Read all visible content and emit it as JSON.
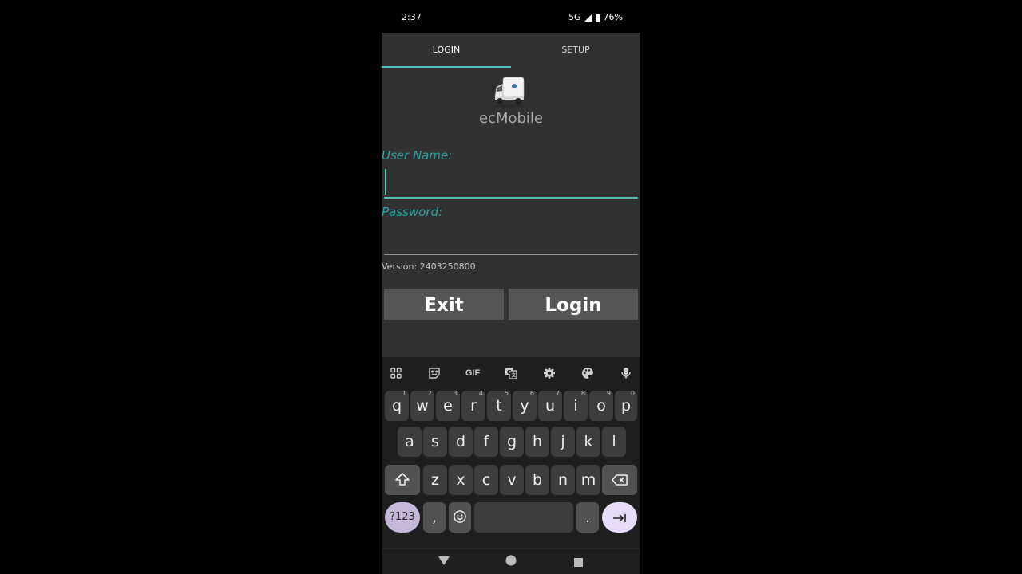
{
  "status_bar": {
    "time": "2:37",
    "network": "5G",
    "battery": "76%"
  },
  "tabs": [
    {
      "label": "LOGIN",
      "active": true
    },
    {
      "label": "SETUP",
      "active": false
    }
  ],
  "app": {
    "name": "ecMobile",
    "logo_icon": "delivery-truck-icon"
  },
  "form": {
    "username_label": "User Name:",
    "username_value": "",
    "password_label": "Password:",
    "password_value": ""
  },
  "version_text": "Version: 2403250800",
  "buttons": {
    "exit": "Exit",
    "login": "Login"
  },
  "keyboard": {
    "toolbar": [
      "apps-grid-icon",
      "sticker-icon",
      "GIF",
      "translate-icon",
      "gear-icon",
      "palette-icon",
      "microphone-icon"
    ],
    "gif_label": "GIF",
    "row1": [
      "q",
      "w",
      "e",
      "r",
      "t",
      "y",
      "u",
      "i",
      "o",
      "p"
    ],
    "row1_hints": [
      "1",
      "2",
      "3",
      "4",
      "5",
      "6",
      "7",
      "8",
      "9",
      "0"
    ],
    "row2": [
      "a",
      "s",
      "d",
      "f",
      "g",
      "h",
      "j",
      "k",
      "l"
    ],
    "row3": [
      "z",
      "x",
      "c",
      "v",
      "b",
      "n",
      "m"
    ],
    "symbols_key": "?123",
    "comma_key": ",",
    "period_key": "."
  },
  "colors": {
    "accent": "#4fc3b8",
    "label": "#2aa3a3",
    "background": "#313131",
    "button": "#555555"
  }
}
